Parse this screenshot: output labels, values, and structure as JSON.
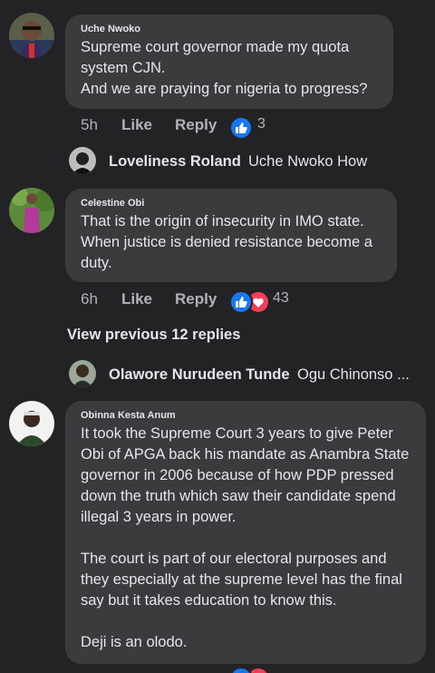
{
  "comments": [
    {
      "author": "Uche Nwoko",
      "text": "Supreme court governor made my quota system CJN.\nAnd we are praying for nigeria to progress?",
      "time": "5h",
      "like_label": "Like",
      "reply_label": "Reply",
      "reactions": [
        "like-reaction-icon"
      ],
      "reaction_count": "3"
    },
    {
      "author": "Celestine Obi",
      "text": "That is the origin of insecurity in IMO state. When justice is denied resistance become a duty.",
      "time": "6h",
      "like_label": "Like",
      "reply_label": "Reply",
      "reactions": [
        "like-reaction-icon",
        "love-reaction-icon"
      ],
      "reaction_count": "43"
    },
    {
      "author": "Obinna Kesta Anum",
      "text": "It took the Supreme Court 3 years to give Peter Obi of APGA back his mandate as Anambra State governor in 2006 because of how PDP pressed down the truth which saw their candidate spend illegal 3 years in power.\n\nThe court is part of our electoral purposes and they especially at the supreme level has the final say but it takes education to know this.\n\nDeji is an olodo."
    }
  ],
  "reply_previews": [
    {
      "name": "Loveliness Roland",
      "text": "Uche Nwoko How"
    },
    {
      "name": "Olawore Nurudeen Tunde",
      "text": "Ogu Chinonso ..."
    }
  ],
  "view_previous": "View previous 12 replies",
  "colors": {
    "background": "#232325",
    "bubble": "#3a3b3c",
    "like_blue": "#1877f2",
    "love_red": "#f33e58"
  }
}
